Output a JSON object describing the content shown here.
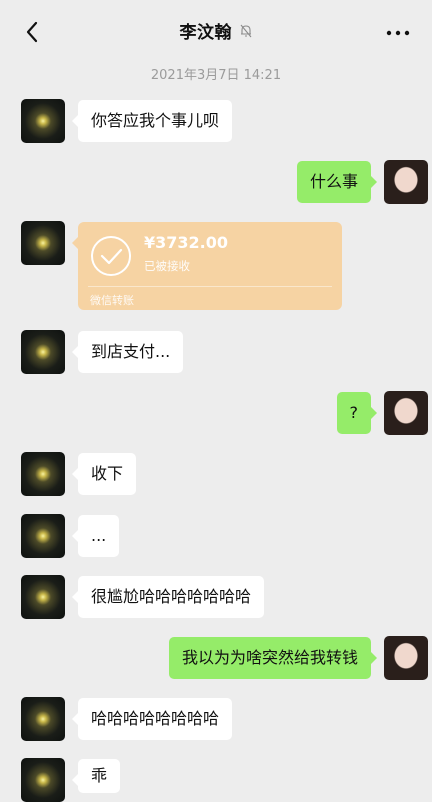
{
  "header": {
    "contact_name": "李汶翰"
  },
  "timestamp": "2021年3月7日 14:21",
  "messages": [
    {
      "side": "in",
      "text": "你答应我个事儿呗"
    },
    {
      "side": "out",
      "text": "什么事"
    },
    {
      "side": "in",
      "type": "transfer",
      "amount": "¥3732.00",
      "status": "已被接收",
      "label": "微信转账"
    },
    {
      "side": "in",
      "text": "到店支付..."
    },
    {
      "side": "out",
      "text": "?"
    },
    {
      "side": "in",
      "text": "收下"
    },
    {
      "side": "in",
      "text": "..."
    },
    {
      "side": "in",
      "text": "很尴尬哈哈哈哈哈哈哈"
    },
    {
      "side": "out",
      "text": "我以为为啥突然给我转钱"
    },
    {
      "side": "in",
      "text": "哈哈哈哈哈哈哈哈"
    },
    {
      "side": "in",
      "text": "乖"
    }
  ],
  "colors": {
    "background": "#ededed",
    "outgoing_bubble": "#95ec69",
    "incoming_bubble": "#ffffff",
    "transfer_card": "#f6d3a3"
  }
}
